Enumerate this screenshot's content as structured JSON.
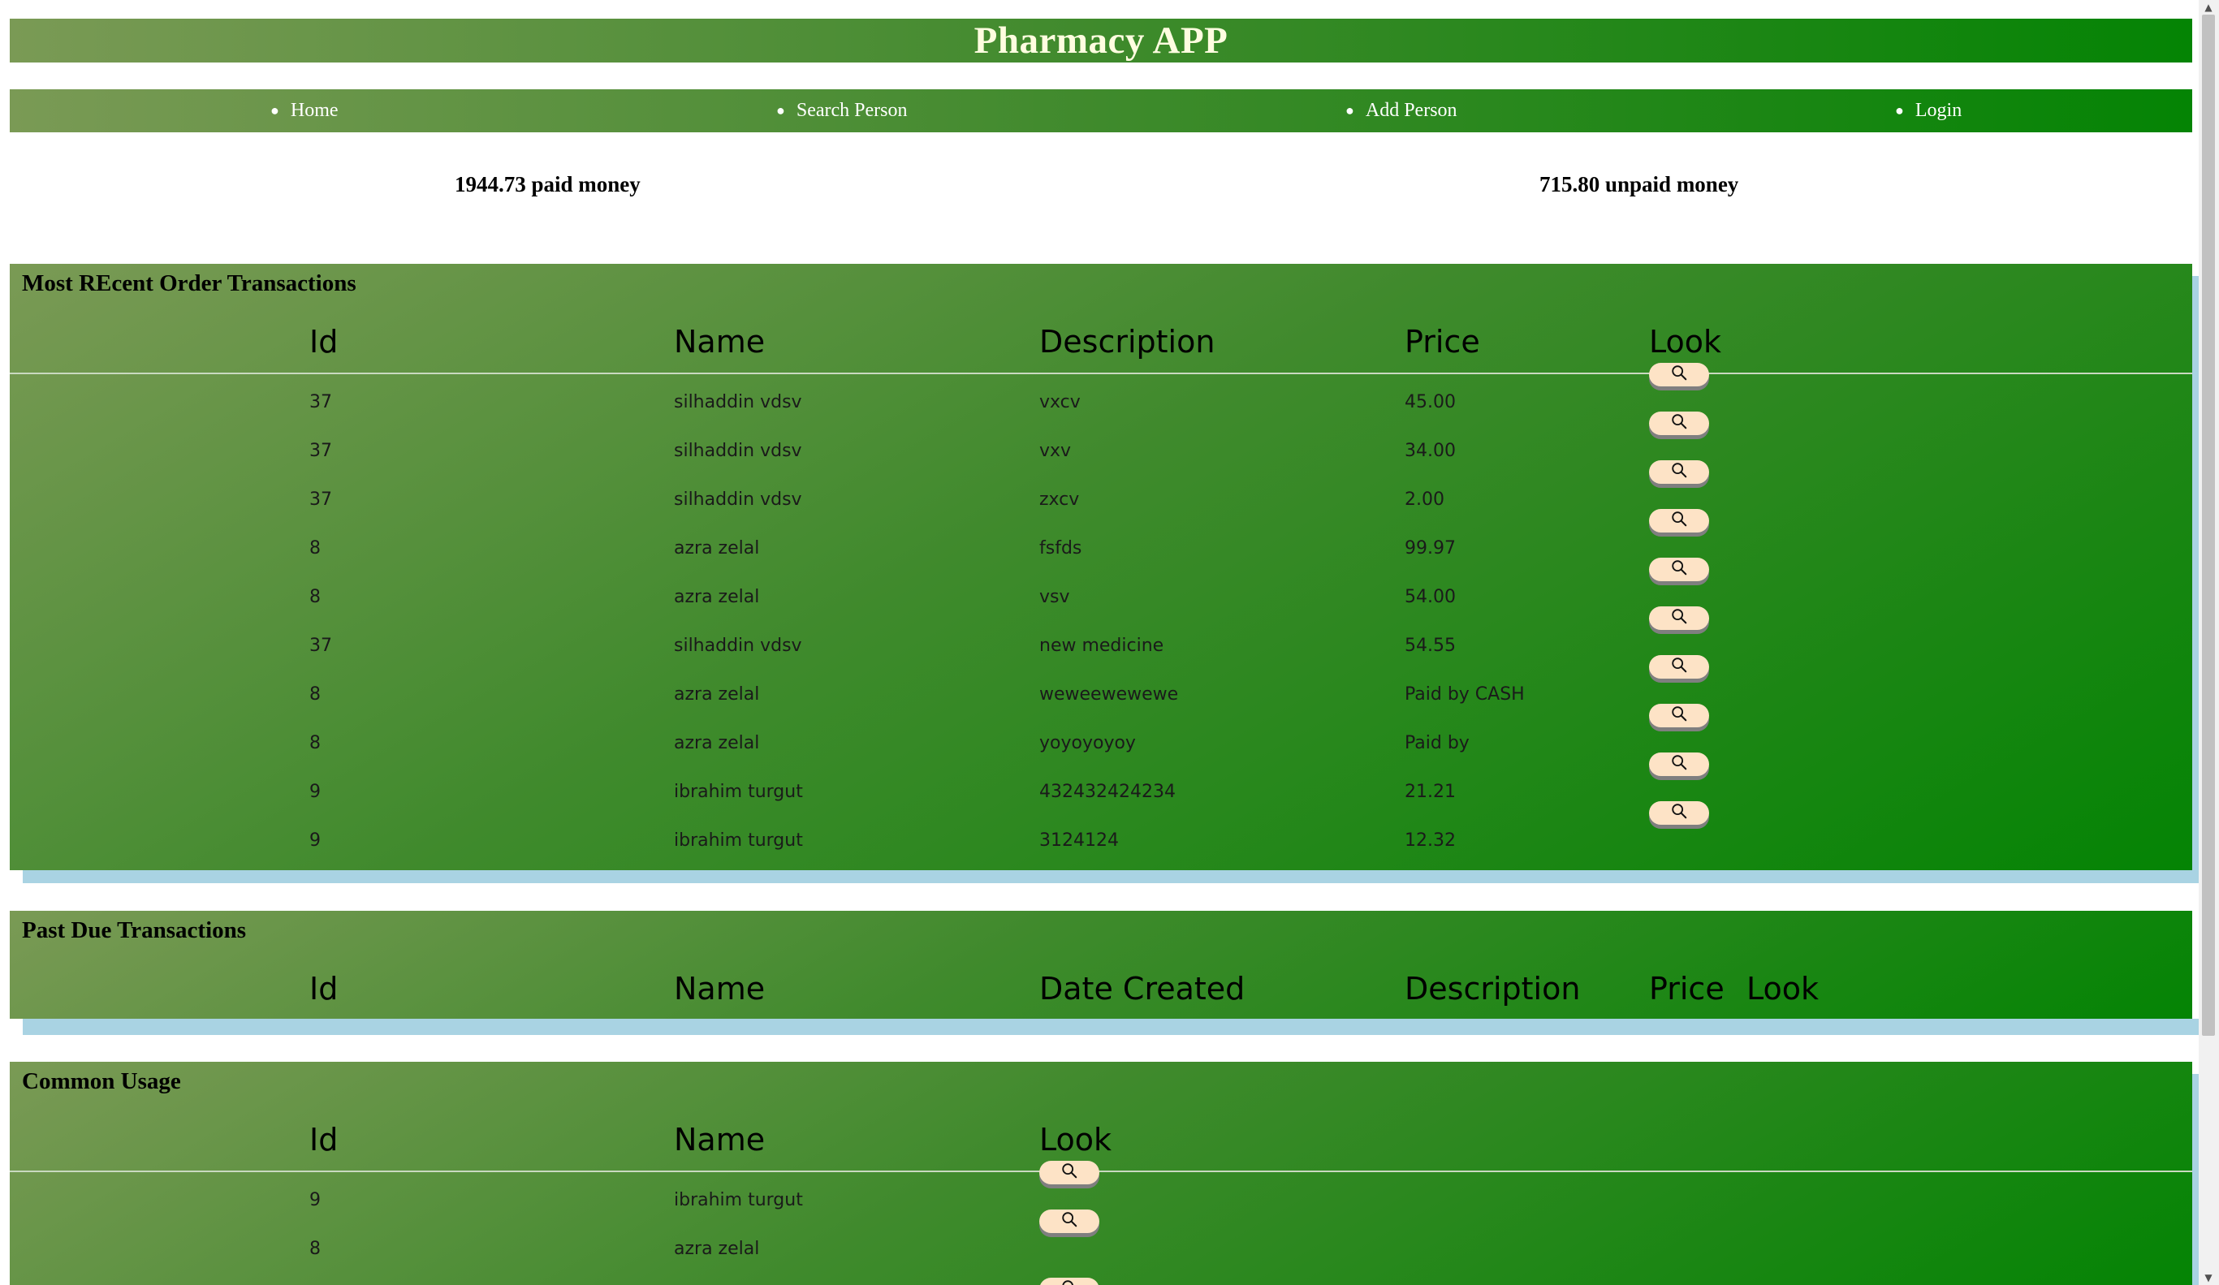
{
  "app": {
    "title": "Pharmacy APP"
  },
  "nav": {
    "items": [
      {
        "label": "Home"
      },
      {
        "label": "Search Person"
      },
      {
        "label": "Add Person"
      },
      {
        "label": "Login"
      }
    ]
  },
  "summary": {
    "paid": "1944.73 paid money",
    "unpaid": "715.80 unpaid money"
  },
  "recent": {
    "title": "Most REcent Order Transactions",
    "columns": [
      "Id",
      "Name",
      "Description",
      "Price",
      "Look"
    ],
    "rows": [
      {
        "id": "37",
        "name": "silhaddin vdsv",
        "description": "vxcv",
        "price": "45.00"
      },
      {
        "id": "37",
        "name": "silhaddin vdsv",
        "description": "vxv",
        "price": "34.00"
      },
      {
        "id": "37",
        "name": "silhaddin vdsv",
        "description": "zxcv",
        "price": "2.00"
      },
      {
        "id": "8",
        "name": "azra zelal",
        "description": "fsfds",
        "price": "99.97"
      },
      {
        "id": "8",
        "name": "azra zelal",
        "description": "vsv",
        "price": "54.00"
      },
      {
        "id": "37",
        "name": "silhaddin vdsv",
        "description": "new medicine",
        "price": "54.55"
      },
      {
        "id": "8",
        "name": "azra zelal",
        "description": "weweewewewe",
        "price": "Paid by CASH"
      },
      {
        "id": "8",
        "name": "azra zelal",
        "description": "yoyoyoyoy",
        "price": "Paid by"
      },
      {
        "id": "9",
        "name": "ibrahim turgut",
        "description": "432432424234",
        "price": "21.21"
      },
      {
        "id": "9",
        "name": "ibrahim turgut",
        "description": "3124124",
        "price": "12.32"
      }
    ]
  },
  "pastdue": {
    "title": "Past Due Transactions",
    "columns": [
      "Id",
      "Name",
      "Date Created",
      "Description",
      "Price",
      "Look"
    ]
  },
  "common": {
    "title": "Common Usage",
    "columns": [
      "Id",
      "Name",
      "Look"
    ],
    "rows": [
      {
        "id": "9",
        "name": "ibrahim turgut"
      },
      {
        "id": "8",
        "name": "azra zelal"
      }
    ]
  },
  "icons": {
    "look": "search-icon",
    "nav_bullet": "bullet"
  },
  "colors": {
    "header_start": "#7a9a55",
    "header_end": "#048404",
    "title_text": "#fffde0",
    "look_button": "#fde3c6",
    "panel_shadow": "#a9d3e3"
  }
}
